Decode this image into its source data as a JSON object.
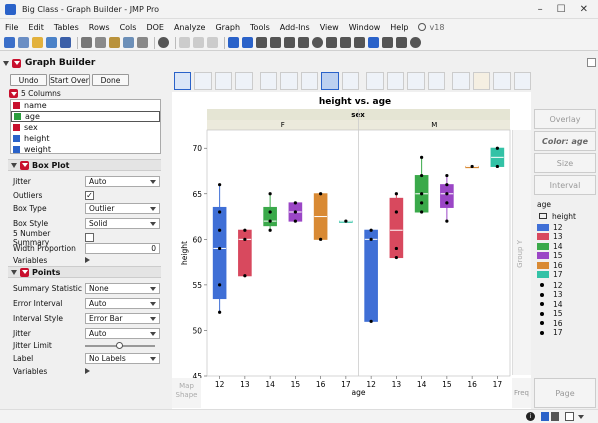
{
  "window": {
    "title": "Big Class - Graph Builder - JMP Pro"
  },
  "menu": {
    "items": [
      "File",
      "Edit",
      "Tables",
      "Rows",
      "Cols",
      "DOE",
      "Analyze",
      "Graph",
      "Tools",
      "Add-Ins",
      "View",
      "Window",
      "Help"
    ],
    "version": "v18"
  },
  "builder": {
    "title": "Graph Builder",
    "buttons": {
      "undo": "Undo",
      "start_over": "Start Over",
      "done": "Done"
    },
    "columns_header": "5 Columns",
    "columns": [
      {
        "name": "name",
        "icon_color": "#c8102e"
      },
      {
        "name": "age",
        "icon_color": "#2a9d3c",
        "selected": true
      },
      {
        "name": "sex",
        "icon_color": "#c8102e"
      },
      {
        "name": "height",
        "icon_color": "#2a62c9"
      },
      {
        "name": "weight",
        "icon_color": "#2a62c9"
      }
    ]
  },
  "box_plot": {
    "header": "Box Plot",
    "jitter_label": "Jitter",
    "jitter_value": "Auto",
    "outliers_label": "Outliers",
    "box_type_label": "Box Type",
    "box_type_value": "Outlier",
    "box_style_label": "Box Style",
    "box_style_value": "Solid",
    "five_number_label": "5 Number Summary",
    "width_proportion_label": "Width Proportion",
    "width_proportion_value": "0",
    "variables_label": "Variables"
  },
  "points": {
    "header": "Points",
    "summary_statistic_label": "Summary Statistic",
    "summary_statistic_value": "None",
    "error_interval_label": "Error Interval",
    "error_interval_value": "Auto",
    "interval_style_label": "Interval Style",
    "interval_style_value": "Error Bar",
    "jitter_label": "Jitter",
    "jitter_value": "Auto",
    "jitter_limit_label": "Jitter Limit",
    "label_label": "Label",
    "label_value": "No Labels",
    "variables_label": "Variables"
  },
  "zones": {
    "map_shape": "Map\nShape",
    "group_y": "Group Y",
    "freq": "Freq",
    "page": "Page",
    "overlay": "Overlay",
    "color": "Color: age",
    "size": "Size",
    "interval": "Interval"
  },
  "legend": {
    "title": "age",
    "measure": "height",
    "items": [
      {
        "label": "12",
        "color": "#3f6fd6"
      },
      {
        "label": "13",
        "color": "#d8495e"
      },
      {
        "label": "14",
        "color": "#3aa94a"
      },
      {
        "label": "15",
        "color": "#9b46c6"
      },
      {
        "label": "16",
        "color": "#d98a34"
      },
      {
        "label": "17",
        "color": "#33c2a6"
      }
    ],
    "point_labels": [
      "12",
      "13",
      "14",
      "15",
      "16",
      "17"
    ]
  },
  "chart_data": {
    "type": "box",
    "title": "height vs. age",
    "group_title": "sex",
    "groups": [
      "F",
      "M"
    ],
    "xlabel": "age",
    "ylabel": "height",
    "ylim": [
      45,
      72
    ],
    "yticks": [
      45,
      50,
      55,
      60,
      65,
      70
    ],
    "categories": [
      "12",
      "13",
      "14",
      "15",
      "16",
      "17"
    ],
    "boxes": {
      "F": [
        {
          "age": "12",
          "q1": 53.5,
          "median": 59,
          "q3": 63.5,
          "min": 52,
          "max": 66,
          "points": [
            52,
            55,
            59,
            61,
            63,
            66
          ]
        },
        {
          "age": "13",
          "q1": 56,
          "median": 60,
          "q3": 61,
          "min": 56,
          "max": 61,
          "points": [
            56,
            60,
            61
          ]
        },
        {
          "age": "14",
          "q1": 61.5,
          "median": 62,
          "q3": 63.5,
          "min": 61,
          "max": 65,
          "points": [
            61,
            62,
            63,
            65
          ]
        },
        {
          "age": "15",
          "q1": 62,
          "median": 63,
          "q3": 64,
          "min": 62,
          "max": 64,
          "points": [
            62,
            63,
            64
          ]
        },
        {
          "age": "16",
          "q1": 60,
          "median": 62.5,
          "q3": 65,
          "min": 60,
          "max": 65,
          "points": [
            60,
            65
          ]
        },
        {
          "age": "17",
          "q1": 62,
          "median": 62,
          "q3": 62,
          "min": 62,
          "max": 62,
          "points": [
            62
          ]
        }
      ],
      "M": [
        {
          "age": "12",
          "q1": 51,
          "median": 60,
          "q3": 61,
          "min": 51,
          "max": 61,
          "points": [
            51,
            60,
            61
          ]
        },
        {
          "age": "13",
          "q1": 58,
          "median": 61,
          "q3": 64.5,
          "min": 58,
          "max": 65,
          "points": [
            58,
            59,
            63,
            65
          ]
        },
        {
          "age": "14",
          "q1": 63,
          "median": 65,
          "q3": 67,
          "min": 63,
          "max": 69,
          "points": [
            63,
            64,
            65,
            67,
            69
          ]
        },
        {
          "age": "15",
          "q1": 63.5,
          "median": 65,
          "q3": 66,
          "min": 62,
          "max": 67,
          "points": [
            62,
            64,
            65,
            66,
            67
          ]
        },
        {
          "age": "16",
          "q1": 68,
          "median": 68,
          "q3": 68,
          "min": 68,
          "max": 68,
          "points": [
            68
          ]
        },
        {
          "age": "17",
          "q1": 68,
          "median": 69,
          "q3": 70,
          "min": 68,
          "max": 70,
          "points": [
            68,
            70
          ]
        }
      ]
    },
    "colors": [
      "#3f6fd6",
      "#d8495e",
      "#3aa94a",
      "#9b46c6",
      "#d98a34",
      "#33c2a6"
    ]
  }
}
